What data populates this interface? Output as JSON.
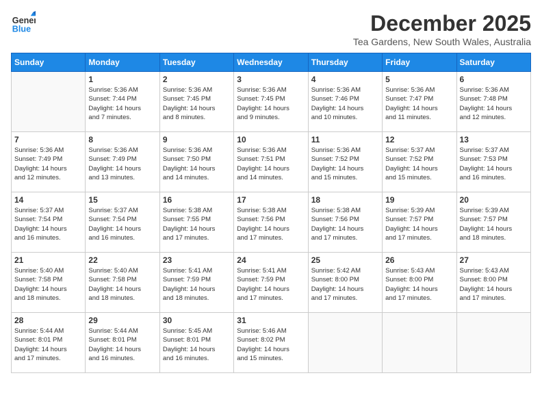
{
  "logo": {
    "line1": "General",
    "line2": "Blue"
  },
  "title": "December 2025",
  "subtitle": "Tea Gardens, New South Wales, Australia",
  "days_of_week": [
    "Sunday",
    "Monday",
    "Tuesday",
    "Wednesday",
    "Thursday",
    "Friday",
    "Saturday"
  ],
  "weeks": [
    [
      {
        "day": "",
        "info": ""
      },
      {
        "day": "1",
        "info": "Sunrise: 5:36 AM\nSunset: 7:44 PM\nDaylight: 14 hours\nand 7 minutes."
      },
      {
        "day": "2",
        "info": "Sunrise: 5:36 AM\nSunset: 7:45 PM\nDaylight: 14 hours\nand 8 minutes."
      },
      {
        "day": "3",
        "info": "Sunrise: 5:36 AM\nSunset: 7:45 PM\nDaylight: 14 hours\nand 9 minutes."
      },
      {
        "day": "4",
        "info": "Sunrise: 5:36 AM\nSunset: 7:46 PM\nDaylight: 14 hours\nand 10 minutes."
      },
      {
        "day": "5",
        "info": "Sunrise: 5:36 AM\nSunset: 7:47 PM\nDaylight: 14 hours\nand 11 minutes."
      },
      {
        "day": "6",
        "info": "Sunrise: 5:36 AM\nSunset: 7:48 PM\nDaylight: 14 hours\nand 12 minutes."
      }
    ],
    [
      {
        "day": "7",
        "info": "Sunrise: 5:36 AM\nSunset: 7:49 PM\nDaylight: 14 hours\nand 12 minutes."
      },
      {
        "day": "8",
        "info": "Sunrise: 5:36 AM\nSunset: 7:49 PM\nDaylight: 14 hours\nand 13 minutes."
      },
      {
        "day": "9",
        "info": "Sunrise: 5:36 AM\nSunset: 7:50 PM\nDaylight: 14 hours\nand 14 minutes."
      },
      {
        "day": "10",
        "info": "Sunrise: 5:36 AM\nSunset: 7:51 PM\nDaylight: 14 hours\nand 14 minutes."
      },
      {
        "day": "11",
        "info": "Sunrise: 5:36 AM\nSunset: 7:52 PM\nDaylight: 14 hours\nand 15 minutes."
      },
      {
        "day": "12",
        "info": "Sunrise: 5:37 AM\nSunset: 7:52 PM\nDaylight: 14 hours\nand 15 minutes."
      },
      {
        "day": "13",
        "info": "Sunrise: 5:37 AM\nSunset: 7:53 PM\nDaylight: 14 hours\nand 16 minutes."
      }
    ],
    [
      {
        "day": "14",
        "info": "Sunrise: 5:37 AM\nSunset: 7:54 PM\nDaylight: 14 hours\nand 16 minutes."
      },
      {
        "day": "15",
        "info": "Sunrise: 5:37 AM\nSunset: 7:54 PM\nDaylight: 14 hours\nand 16 minutes."
      },
      {
        "day": "16",
        "info": "Sunrise: 5:38 AM\nSunset: 7:55 PM\nDaylight: 14 hours\nand 17 minutes."
      },
      {
        "day": "17",
        "info": "Sunrise: 5:38 AM\nSunset: 7:56 PM\nDaylight: 14 hours\nand 17 minutes."
      },
      {
        "day": "18",
        "info": "Sunrise: 5:38 AM\nSunset: 7:56 PM\nDaylight: 14 hours\nand 17 minutes."
      },
      {
        "day": "19",
        "info": "Sunrise: 5:39 AM\nSunset: 7:57 PM\nDaylight: 14 hours\nand 17 minutes."
      },
      {
        "day": "20",
        "info": "Sunrise: 5:39 AM\nSunset: 7:57 PM\nDaylight: 14 hours\nand 18 minutes."
      }
    ],
    [
      {
        "day": "21",
        "info": "Sunrise: 5:40 AM\nSunset: 7:58 PM\nDaylight: 14 hours\nand 18 minutes."
      },
      {
        "day": "22",
        "info": "Sunrise: 5:40 AM\nSunset: 7:58 PM\nDaylight: 14 hours\nand 18 minutes."
      },
      {
        "day": "23",
        "info": "Sunrise: 5:41 AM\nSunset: 7:59 PM\nDaylight: 14 hours\nand 18 minutes."
      },
      {
        "day": "24",
        "info": "Sunrise: 5:41 AM\nSunset: 7:59 PM\nDaylight: 14 hours\nand 17 minutes."
      },
      {
        "day": "25",
        "info": "Sunrise: 5:42 AM\nSunset: 8:00 PM\nDaylight: 14 hours\nand 17 minutes."
      },
      {
        "day": "26",
        "info": "Sunrise: 5:43 AM\nSunset: 8:00 PM\nDaylight: 14 hours\nand 17 minutes."
      },
      {
        "day": "27",
        "info": "Sunrise: 5:43 AM\nSunset: 8:00 PM\nDaylight: 14 hours\nand 17 minutes."
      }
    ],
    [
      {
        "day": "28",
        "info": "Sunrise: 5:44 AM\nSunset: 8:01 PM\nDaylight: 14 hours\nand 17 minutes."
      },
      {
        "day": "29",
        "info": "Sunrise: 5:44 AM\nSunset: 8:01 PM\nDaylight: 14 hours\nand 16 minutes."
      },
      {
        "day": "30",
        "info": "Sunrise: 5:45 AM\nSunset: 8:01 PM\nDaylight: 14 hours\nand 16 minutes."
      },
      {
        "day": "31",
        "info": "Sunrise: 5:46 AM\nSunset: 8:02 PM\nDaylight: 14 hours\nand 15 minutes."
      },
      {
        "day": "",
        "info": ""
      },
      {
        "day": "",
        "info": ""
      },
      {
        "day": "",
        "info": ""
      }
    ]
  ]
}
